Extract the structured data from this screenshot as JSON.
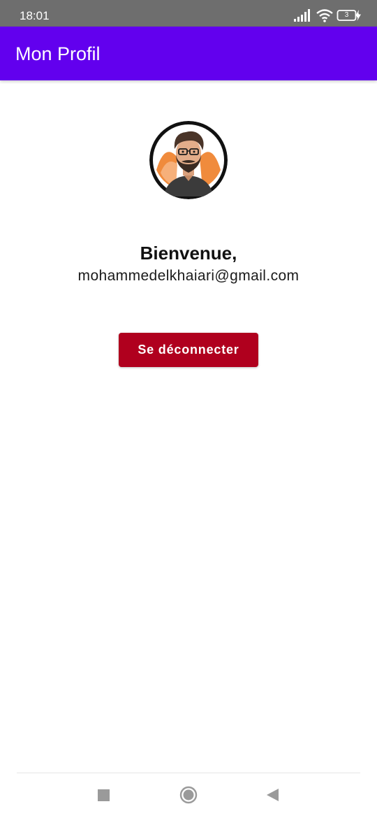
{
  "status_bar": {
    "time": "18:01",
    "battery_level": "3",
    "icons": [
      "signal-icon",
      "wifi-icon",
      "battery-icon",
      "charging-icon"
    ]
  },
  "app_bar": {
    "title": "Mon Profil",
    "color": "#6200ee"
  },
  "profile": {
    "avatar": "profile-avatar",
    "greeting": "Bienvenue,",
    "email": "mohammedelkhaiari@gmail.com"
  },
  "actions": {
    "logout_label": "Se déconnecter",
    "logout_color": "#b0001e"
  },
  "navigation_bar": {
    "buttons": [
      "recent-apps-icon",
      "home-icon",
      "back-icon"
    ]
  }
}
